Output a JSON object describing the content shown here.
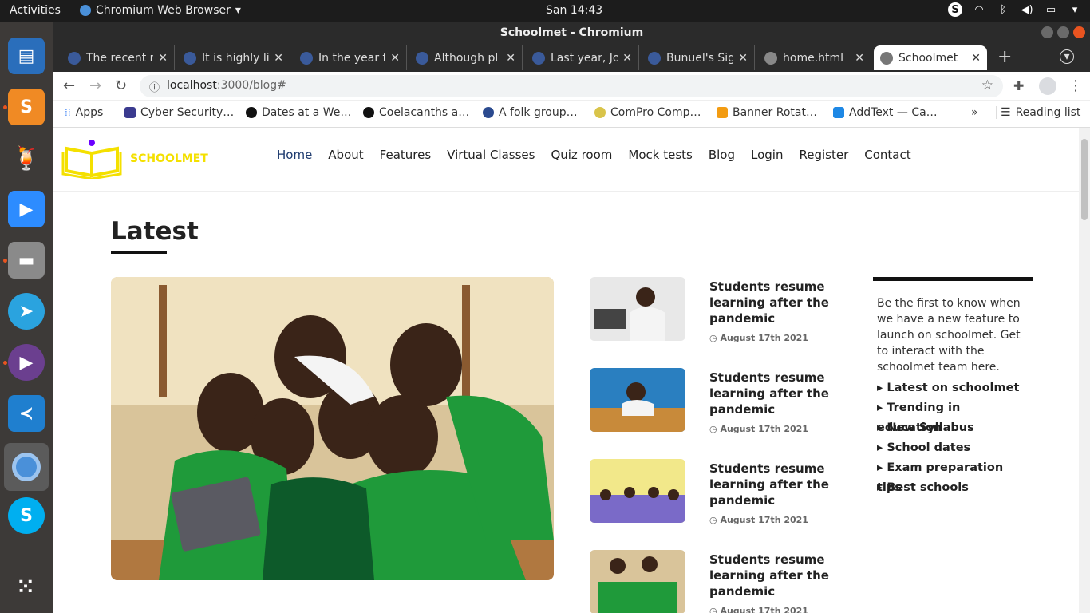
{
  "topbar": {
    "activities": "Activities",
    "app_name": "Chromium Web Browser",
    "clock": "San 14:43"
  },
  "window": {
    "title": "Schoolmet - Chromium"
  },
  "tabs": [
    {
      "label": "The recent r"
    },
    {
      "label": "It is highly li"
    },
    {
      "label": "In the year f"
    },
    {
      "label": "Although pl"
    },
    {
      "label": "Last year, Jo"
    },
    {
      "label": "Bunuel's Sig"
    },
    {
      "label": "home.html"
    },
    {
      "label": "Schoolmet"
    }
  ],
  "address": {
    "host": "localhost",
    "path": ":3000/blog#"
  },
  "bookmarks": [
    {
      "label": "Apps",
      "color": "#4285f4"
    },
    {
      "label": "Cyber Security…",
      "color": "#3b3b8f"
    },
    {
      "label": "Dates at a We…",
      "color": "#111111"
    },
    {
      "label": "Coelacanths a…",
      "color": "#111111"
    },
    {
      "label": "A folk group…",
      "color": "#2b4a8f"
    },
    {
      "label": "ComPro Comp…",
      "color": "#d9c44a"
    },
    {
      "label": "Banner Rotat…",
      "color": "#f39c12"
    },
    {
      "label": "AddText — Ca…",
      "color": "#1e88e5"
    }
  ],
  "bookmarks_more": "»",
  "reading_list": "Reading list",
  "site": {
    "brand": "SCHOOLMET",
    "nav": [
      "Home",
      "About",
      "Features",
      "Virtual Classes",
      "Quiz room",
      "Mock tests",
      "Blog",
      "Login",
      "Register",
      "Contact"
    ],
    "section_title": "Latest",
    "posts": [
      {
        "title": "Students resume learning after the pandemic",
        "date": "August 17th 2021"
      },
      {
        "title": "Students resume learning after the pandemic",
        "date": "August 17th 2021"
      },
      {
        "title": "Students resume learning after the pandemic",
        "date": "August 17th 2021"
      },
      {
        "title": "Students resume learning after the pandemic",
        "date": "August 17th 2021"
      }
    ],
    "sidebar": {
      "intro": "Be the first to know when we have a new feature to launch on schoolmet. Get to interact with the schoolmet team here.",
      "links": [
        "Latest on schoolmet",
        "Trending in education",
        "New Syllabus",
        "School dates",
        "Exam preparation tips",
        "Best schools"
      ]
    }
  },
  "colors": {
    "nav_active": "#1d3a6e",
    "brand_yellow": "#f4e000",
    "ubuntu_orange": "#e95420"
  }
}
